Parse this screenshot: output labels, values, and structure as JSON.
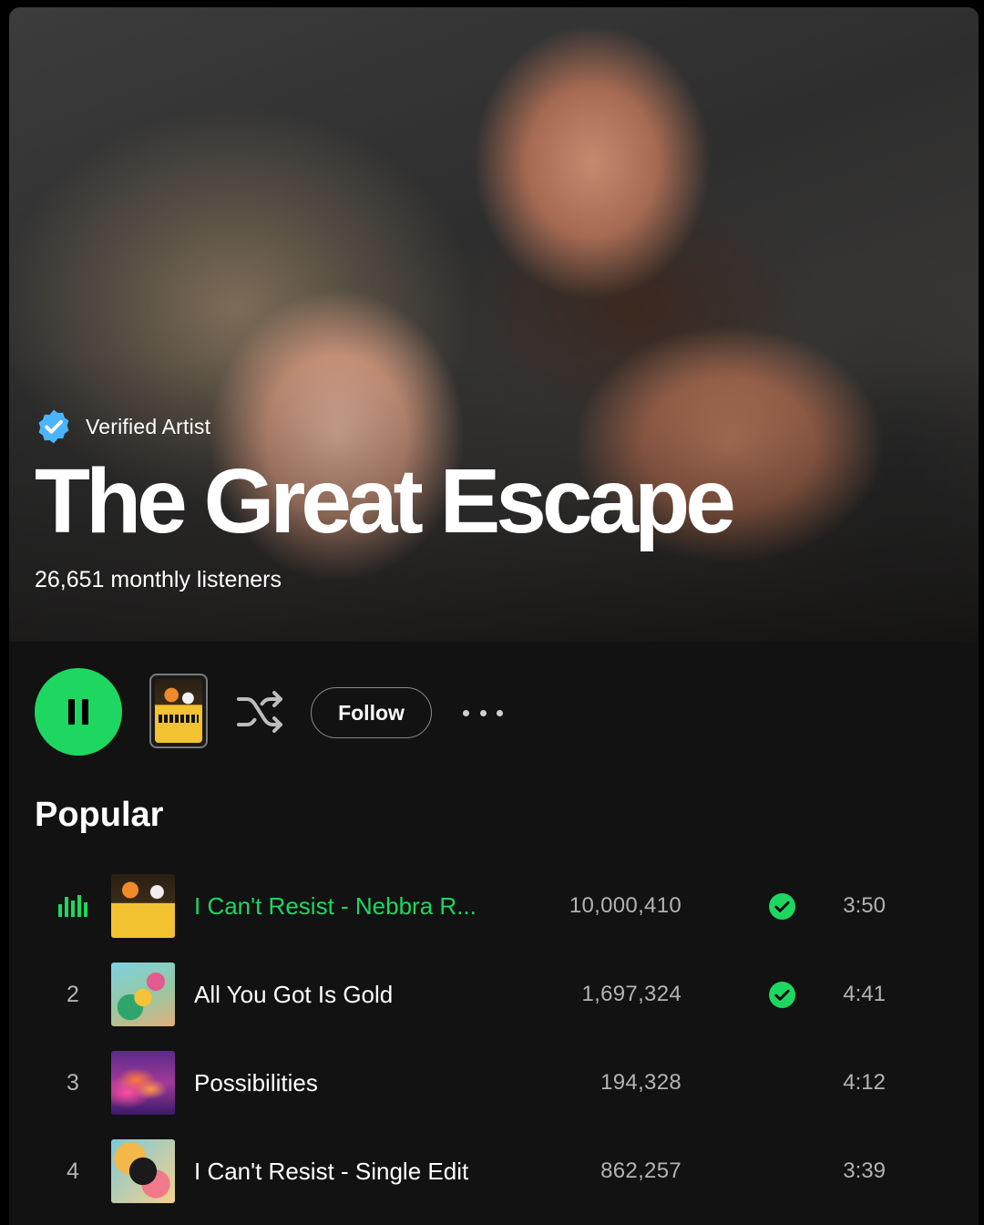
{
  "hero": {
    "verified_label": "Verified Artist",
    "artist_name": "The Great Escape",
    "monthly_listeners": "26,651 monthly listeners"
  },
  "controls": {
    "follow_label": "Follow",
    "play_state": "playing"
  },
  "popular": {
    "title": "Popular",
    "tracks": [
      {
        "index": "",
        "now_playing": true,
        "title": "I Can't Resist - Nebbra R...",
        "plays": "10,000,410",
        "saved": true,
        "duration": "3:50"
      },
      {
        "index": "2",
        "now_playing": false,
        "title": "All You Got Is Gold",
        "plays": "1,697,324",
        "saved": true,
        "duration": "4:41"
      },
      {
        "index": "3",
        "now_playing": false,
        "title": "Possibilities",
        "plays": "194,328",
        "saved": false,
        "duration": "4:12"
      },
      {
        "index": "4",
        "now_playing": false,
        "title": "I Can't Resist - Single Edit",
        "plays": "862,257",
        "saved": false,
        "duration": "3:39"
      }
    ]
  },
  "colors": {
    "accent": "#1ed760",
    "background": "#121212",
    "verified_badge": "#4cb3ff",
    "secondary_text": "#b3b3b3"
  },
  "icons": {
    "verified": "verified-badge-icon",
    "play": "pause-icon",
    "shuffle": "shuffle-icon",
    "more": "more-dots-icon",
    "now_playing": "equalizer-icon",
    "saved": "check-circle-icon"
  }
}
